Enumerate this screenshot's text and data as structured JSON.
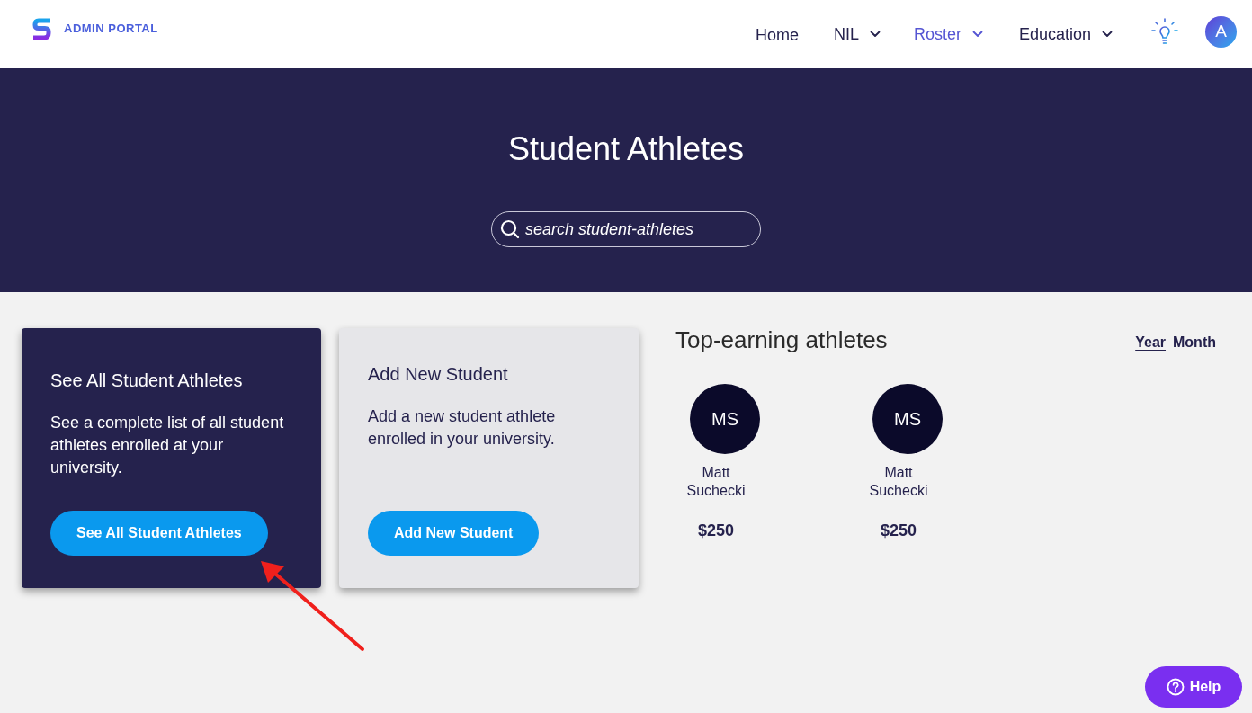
{
  "header": {
    "logo_text": "ADMIN PORTAL",
    "nav": [
      {
        "label": "Home",
        "dropdown": false,
        "selected": false
      },
      {
        "label": "NIL",
        "dropdown": true,
        "selected": false
      },
      {
        "label": "Roster",
        "dropdown": true,
        "selected": true
      },
      {
        "label": "Education",
        "dropdown": true,
        "selected": false
      }
    ],
    "avatar_initial": "A"
  },
  "hero": {
    "title": "Student Athletes",
    "search": {
      "placeholder": "search student-athletes"
    }
  },
  "cards": [
    {
      "kind": "dark",
      "title": "See All Student Athletes",
      "description": "See a complete list of all student athletes enrolled at your university.",
      "button": "See All Student Athletes"
    },
    {
      "kind": "light",
      "title": "Add New Student",
      "description": "Add a new student athlete enrolled in your university.",
      "button": "Add New Student"
    }
  ],
  "top_earning": {
    "title": "Top-earning athletes",
    "periods": [
      {
        "label": "Year",
        "selected": true
      },
      {
        "label": "Month",
        "selected": false
      }
    ],
    "athletes": [
      {
        "initials": "MS",
        "name": "Matt Suchecki",
        "amount": "$250"
      },
      {
        "initials": "MS",
        "name": "Matt Suchecki",
        "amount": "$250"
      }
    ]
  },
  "help_button": "Help"
}
